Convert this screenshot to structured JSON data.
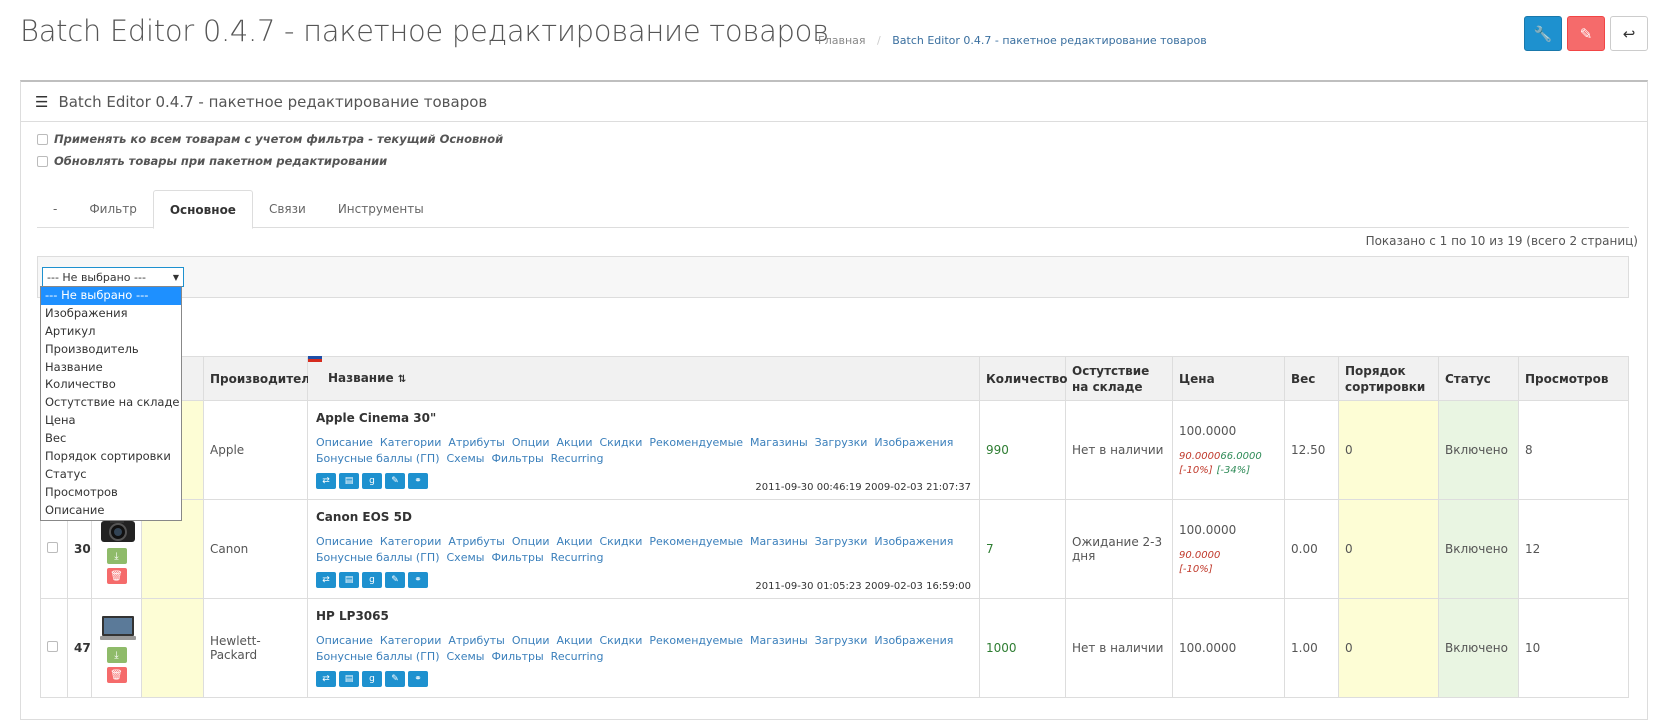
{
  "header": {
    "title": "Batch Editor 0.4.7 - пакетное редактирование товаров",
    "breadcrumb": [
      "Главная",
      "Batch Editor 0.4.7 - пакетное редактирование товаров"
    ],
    "buttons": [
      {
        "name": "settings",
        "icon": "wrench-icon",
        "color": "#1e91cf"
      },
      {
        "name": "clear",
        "icon": "eraser-icon",
        "color": "#f56b6b"
      },
      {
        "name": "back",
        "icon": "reply-icon",
        "color": "#ffffff"
      }
    ]
  },
  "panel": {
    "heading": "Batch Editor 0.4.7 - пакетное редактирование товаров",
    "options": [
      "Применять ко всем товарам с учетом фильтра - текущий Основной",
      "Обновлять товары при пакетном редактировании"
    ],
    "tabs": [
      "-",
      "Фильтр",
      "Основное",
      "Связи",
      "Инструменты"
    ],
    "active_tab": "Основное"
  },
  "select": {
    "value": "--- Не выбрано ---",
    "options": [
      "--- Не выбрано ---",
      "Изображения",
      "Артикул",
      "Производитель",
      "Название",
      "Количество",
      "Остутствие на складе",
      "Цена",
      "Вес",
      "Порядок сортировки",
      "Статус",
      "Просмотров",
      "Описание"
    ]
  },
  "pager": "Показано с 1 по 10 из 19 (всего 2 страниц)",
  "table": {
    "columns": [
      "",
      "",
      "",
      "ул",
      "Производитель",
      "Название",
      "Количество",
      "Остутствие на складе",
      "Цена",
      "Вес",
      "Порядок сортировки",
      "Статус",
      "Просмотров"
    ],
    "links": [
      "Описание",
      "Категории",
      "Атрибуты",
      "Опции",
      "Акции",
      "Скидки",
      "Рекомендуемые",
      "Магазины",
      "Загрузки",
      "Изображения",
      "Бонусные баллы (ГП)",
      "Схемы",
      "Фильтры",
      "Recurring"
    ],
    "rows": [
      {
        "id": "",
        "manufacturer": "Apple",
        "name": "Apple Cinema 30\"",
        "dates": "2011-09-30 00:46:19  2009-02-03 21:07:37",
        "qty": "990",
        "stock": "Нет в наличии",
        "price": "100.0000",
        "special": "90.0000",
        "discount": "66.0000",
        "special_pct": "[-10%]",
        "discount_pct": "[-34%]",
        "weight": "12.50",
        "sort": "0",
        "status": "Включено",
        "views": "8"
      },
      {
        "id": "30",
        "manufacturer": "Canon",
        "name": "Canon EOS 5D",
        "dates": "2011-09-30 01:05:23  2009-02-03 16:59:00",
        "qty": "7",
        "stock": "Ожидание 2-3 дня",
        "price": "100.0000",
        "special": "90.0000",
        "discount": "",
        "special_pct": "[-10%]",
        "discount_pct": "",
        "weight": "0.00",
        "sort": "0",
        "status": "Включено",
        "views": "12"
      },
      {
        "id": "47",
        "manufacturer": "Hewlett-Packard",
        "name": "HP LP3065",
        "dates": "",
        "qty": "1000",
        "stock": "Нет в наличии",
        "price": "100.0000",
        "special": "",
        "discount": "",
        "special_pct": "",
        "discount_pct": "",
        "weight": "1.00",
        "sort": "0",
        "status": "Включено",
        "views": "10"
      }
    ]
  }
}
